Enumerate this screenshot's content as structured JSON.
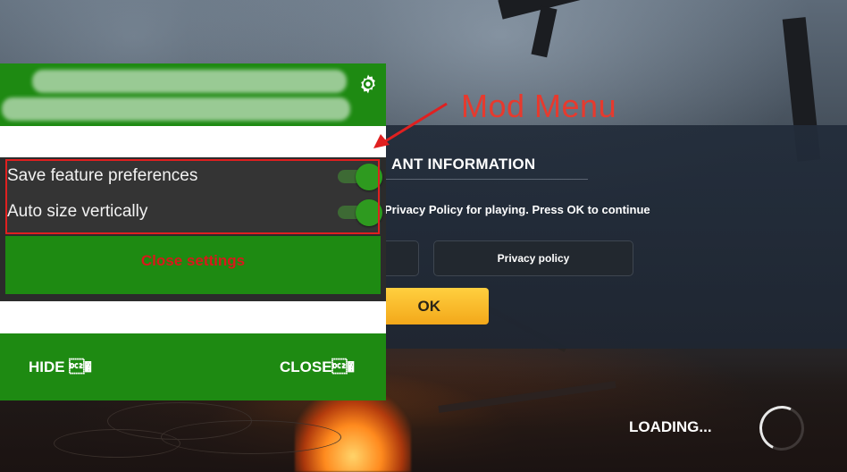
{
  "game": {
    "dialog_title": "ANT INFORMATION",
    "dialog_body": "Privacy Policy for playing. Press OK to continue",
    "privacy_button_label": "Privacy policy",
    "ok_button_label": "OK",
    "loading_label": "LOADING..."
  },
  "mod_menu": {
    "settings": [
      {
        "label": "Save feature preferences",
        "enabled": true
      },
      {
        "label": "Auto size vertically",
        "enabled": true
      }
    ],
    "close_settings_label": "Close settings",
    "hide_button_label": "HIDE \u0012�",
    "close_button_label": "CLOSE\u0012�",
    "gear_icon": "gear-icon",
    "colors": {
      "header": "#1e8a12",
      "close_settings_text": "#d8191a",
      "toggle_on": "#2e9a1f"
    }
  },
  "annotation": {
    "label": "Mod Menu",
    "color": "#e63a2e"
  }
}
